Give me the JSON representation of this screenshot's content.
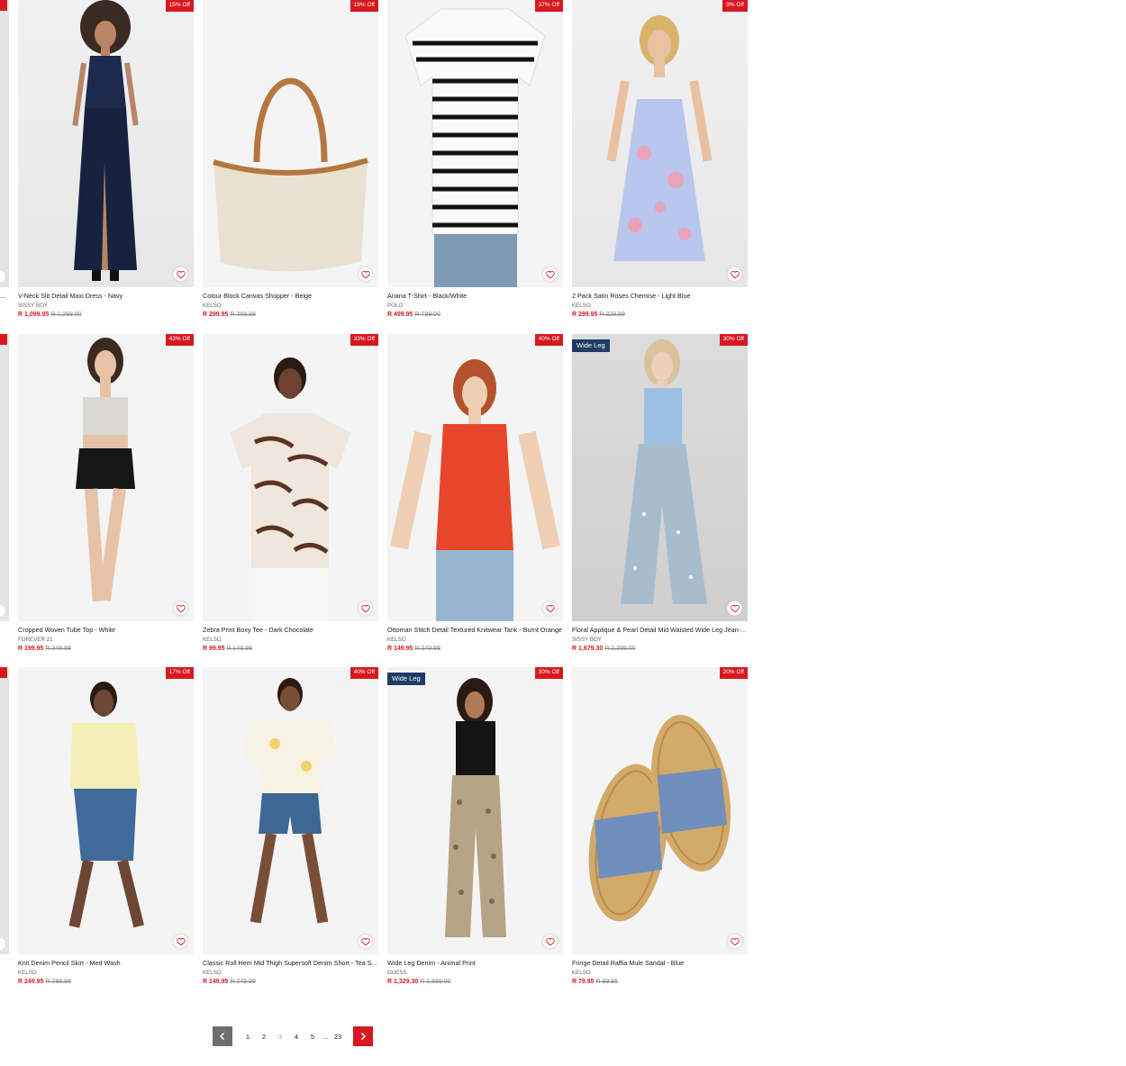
{
  "products": [
    {
      "title": "V-Neck Slit Detail Maxi Dress - Navy",
      "brand": "SISSY BOY",
      "price": "R 1,099.95",
      "was": "R 1,299.00",
      "discount": "15% Off",
      "tag": "",
      "art": "navy-maxi-dress"
    },
    {
      "title": "Colour Block Canvas Shopper - Beige",
      "brand": "KELSO",
      "price": "R 299.95",
      "was": "R 369.99",
      "discount": "19% Off",
      "tag": "",
      "art": "canvas-shopper-bag"
    },
    {
      "title": "Ariana T-Shirt - Black/White",
      "brand": "POLO",
      "price": "R 499.95",
      "was": "R 799.00",
      "discount": "37% Off",
      "tag": "",
      "art": "striped-tshirt"
    },
    {
      "title": "2 Pack Satin Roses Chemise - Light Blue",
      "brand": "KELSO",
      "price": "R 299.95",
      "was": "R 329.99",
      "discount": "9% Off",
      "tag": "",
      "art": "floral-chemise"
    },
    {
      "title": "Cropped Woven Tube Top - White",
      "brand": "FOREVER 21",
      "price": "R 199.95",
      "was": "R 349.99",
      "discount": "43% Off",
      "tag": "",
      "art": "tube-top-shorts"
    },
    {
      "title": "Zebra Print Boxy Tee - Dark Chocolate",
      "brand": "KELSO",
      "price": "R 99.95",
      "was": "R 149.99",
      "discount": "33% Off",
      "tag": "",
      "art": "zebra-tee"
    },
    {
      "title": "Ottoman Stitch Detail Textured Knitwear Tank - Burnt Orange",
      "brand": "KELSO",
      "price": "R 149.95",
      "was": "R 249.99",
      "discount": "40% Off",
      "tag": "",
      "art": "orange-knit-tank"
    },
    {
      "title": "Floral Applique & Pearl Detail Mid Waisted Wide Leg Jean-...",
      "brand": "SISSY BOY",
      "price": "R 1,679.30",
      "was": "R 2,399.00",
      "discount": "30% Off",
      "tag": "Wide Leg",
      "art": "wide-leg-jeans"
    },
    {
      "title": "Knit Denim Pencil Skirt - Med Wash",
      "brand": "KELSO",
      "price": "R 249.95",
      "was": "R 299.99",
      "discount": "17% Off",
      "tag": "",
      "art": "denim-pencil-skirt"
    },
    {
      "title": "Classic Roll Hem Mid Thigh Supersoft Denim Short - Tea S...",
      "brand": "KELSO",
      "price": "R 149.95",
      "was": "R 249.99",
      "discount": "40% Off",
      "tag": "",
      "art": "denim-short"
    },
    {
      "title": "Wide Leg Denim - Animal Print",
      "brand": "GUESS",
      "price": "R 1,329.30",
      "was": "R 1,899.00",
      "discount": "30% Off",
      "tag": "Wide Leg",
      "art": "animal-print-denim"
    },
    {
      "title": "Fringe Detail Raffia Mule Sandal - Blue",
      "brand": "KELSO",
      "price": "R 79.95",
      "was": "R 99.95",
      "discount": "20% Off",
      "tag": "",
      "art": "raffia-mule-sandals"
    }
  ],
  "sliver": {
    "ellipsis": "..."
  },
  "pagination": {
    "prev_icon": "chevron-left-icon",
    "next_icon": "chevron-right-icon",
    "pages": [
      "1",
      "2",
      "3",
      "4",
      "5"
    ],
    "current": "3",
    "ellipsis": "...",
    "last": "23"
  },
  "colors": {
    "accent": "#d7191f",
    "tag": "#1f3b63",
    "pager_prev": "#6e6e6e"
  }
}
